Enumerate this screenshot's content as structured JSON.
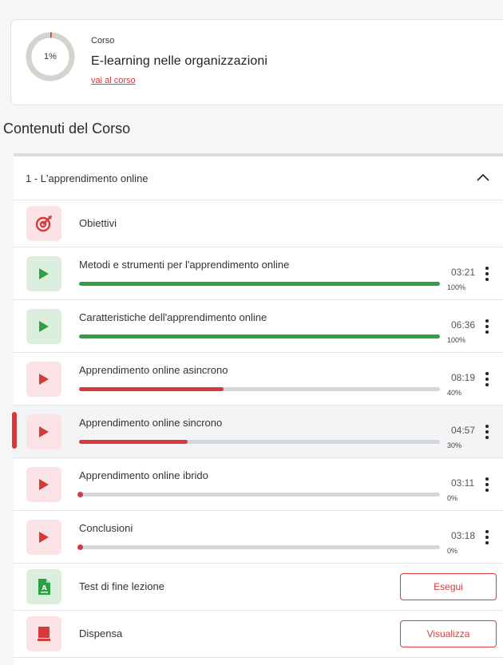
{
  "course": {
    "progress_label": "1%",
    "progress_value": 1,
    "kicker": "Corso",
    "title": "E-learning nelle organizzazioni",
    "link_label": "vai al corso"
  },
  "section_heading": "Contenuti del Corso",
  "module": {
    "title": "1 - L'apprendimento online",
    "expanded": true
  },
  "colors": {
    "accent_red": "#d63a3a",
    "success_green": "#2ea043",
    "track_gray": "#d2d7dc"
  },
  "items": [
    {
      "title": "Obiettivi",
      "icon": "target-icon"
    },
    {
      "title": "Metodi e strumenti per l'apprendimento online",
      "icon": "play-icon",
      "duration": "03:21",
      "percent_label": "100%",
      "progress": 100
    },
    {
      "title": "Caratteristiche dell'apprendimento online",
      "icon": "play-icon",
      "duration": "06:36",
      "percent_label": "100%",
      "progress": 100
    },
    {
      "title": "Apprendimento online asincrono",
      "icon": "play-icon",
      "duration": "08:19",
      "percent_label": "40%",
      "progress": 40
    },
    {
      "title": "Apprendimento online sincrono",
      "icon": "play-icon",
      "duration": "04:57",
      "percent_label": "30%",
      "progress": 30,
      "active": true
    },
    {
      "title": "Apprendimento online ibrido",
      "icon": "play-icon",
      "duration": "03:11",
      "percent_label": "0%",
      "progress": 0
    },
    {
      "title": "Conclusioni",
      "icon": "play-icon",
      "duration": "03:18",
      "percent_label": "0%",
      "progress": 0
    },
    {
      "title": "Test di fine lezione",
      "icon": "quiz-document-icon",
      "button_label": "Esegui"
    },
    {
      "title": "Dispensa",
      "icon": "book-icon",
      "button_label": "Visualizza"
    }
  ]
}
